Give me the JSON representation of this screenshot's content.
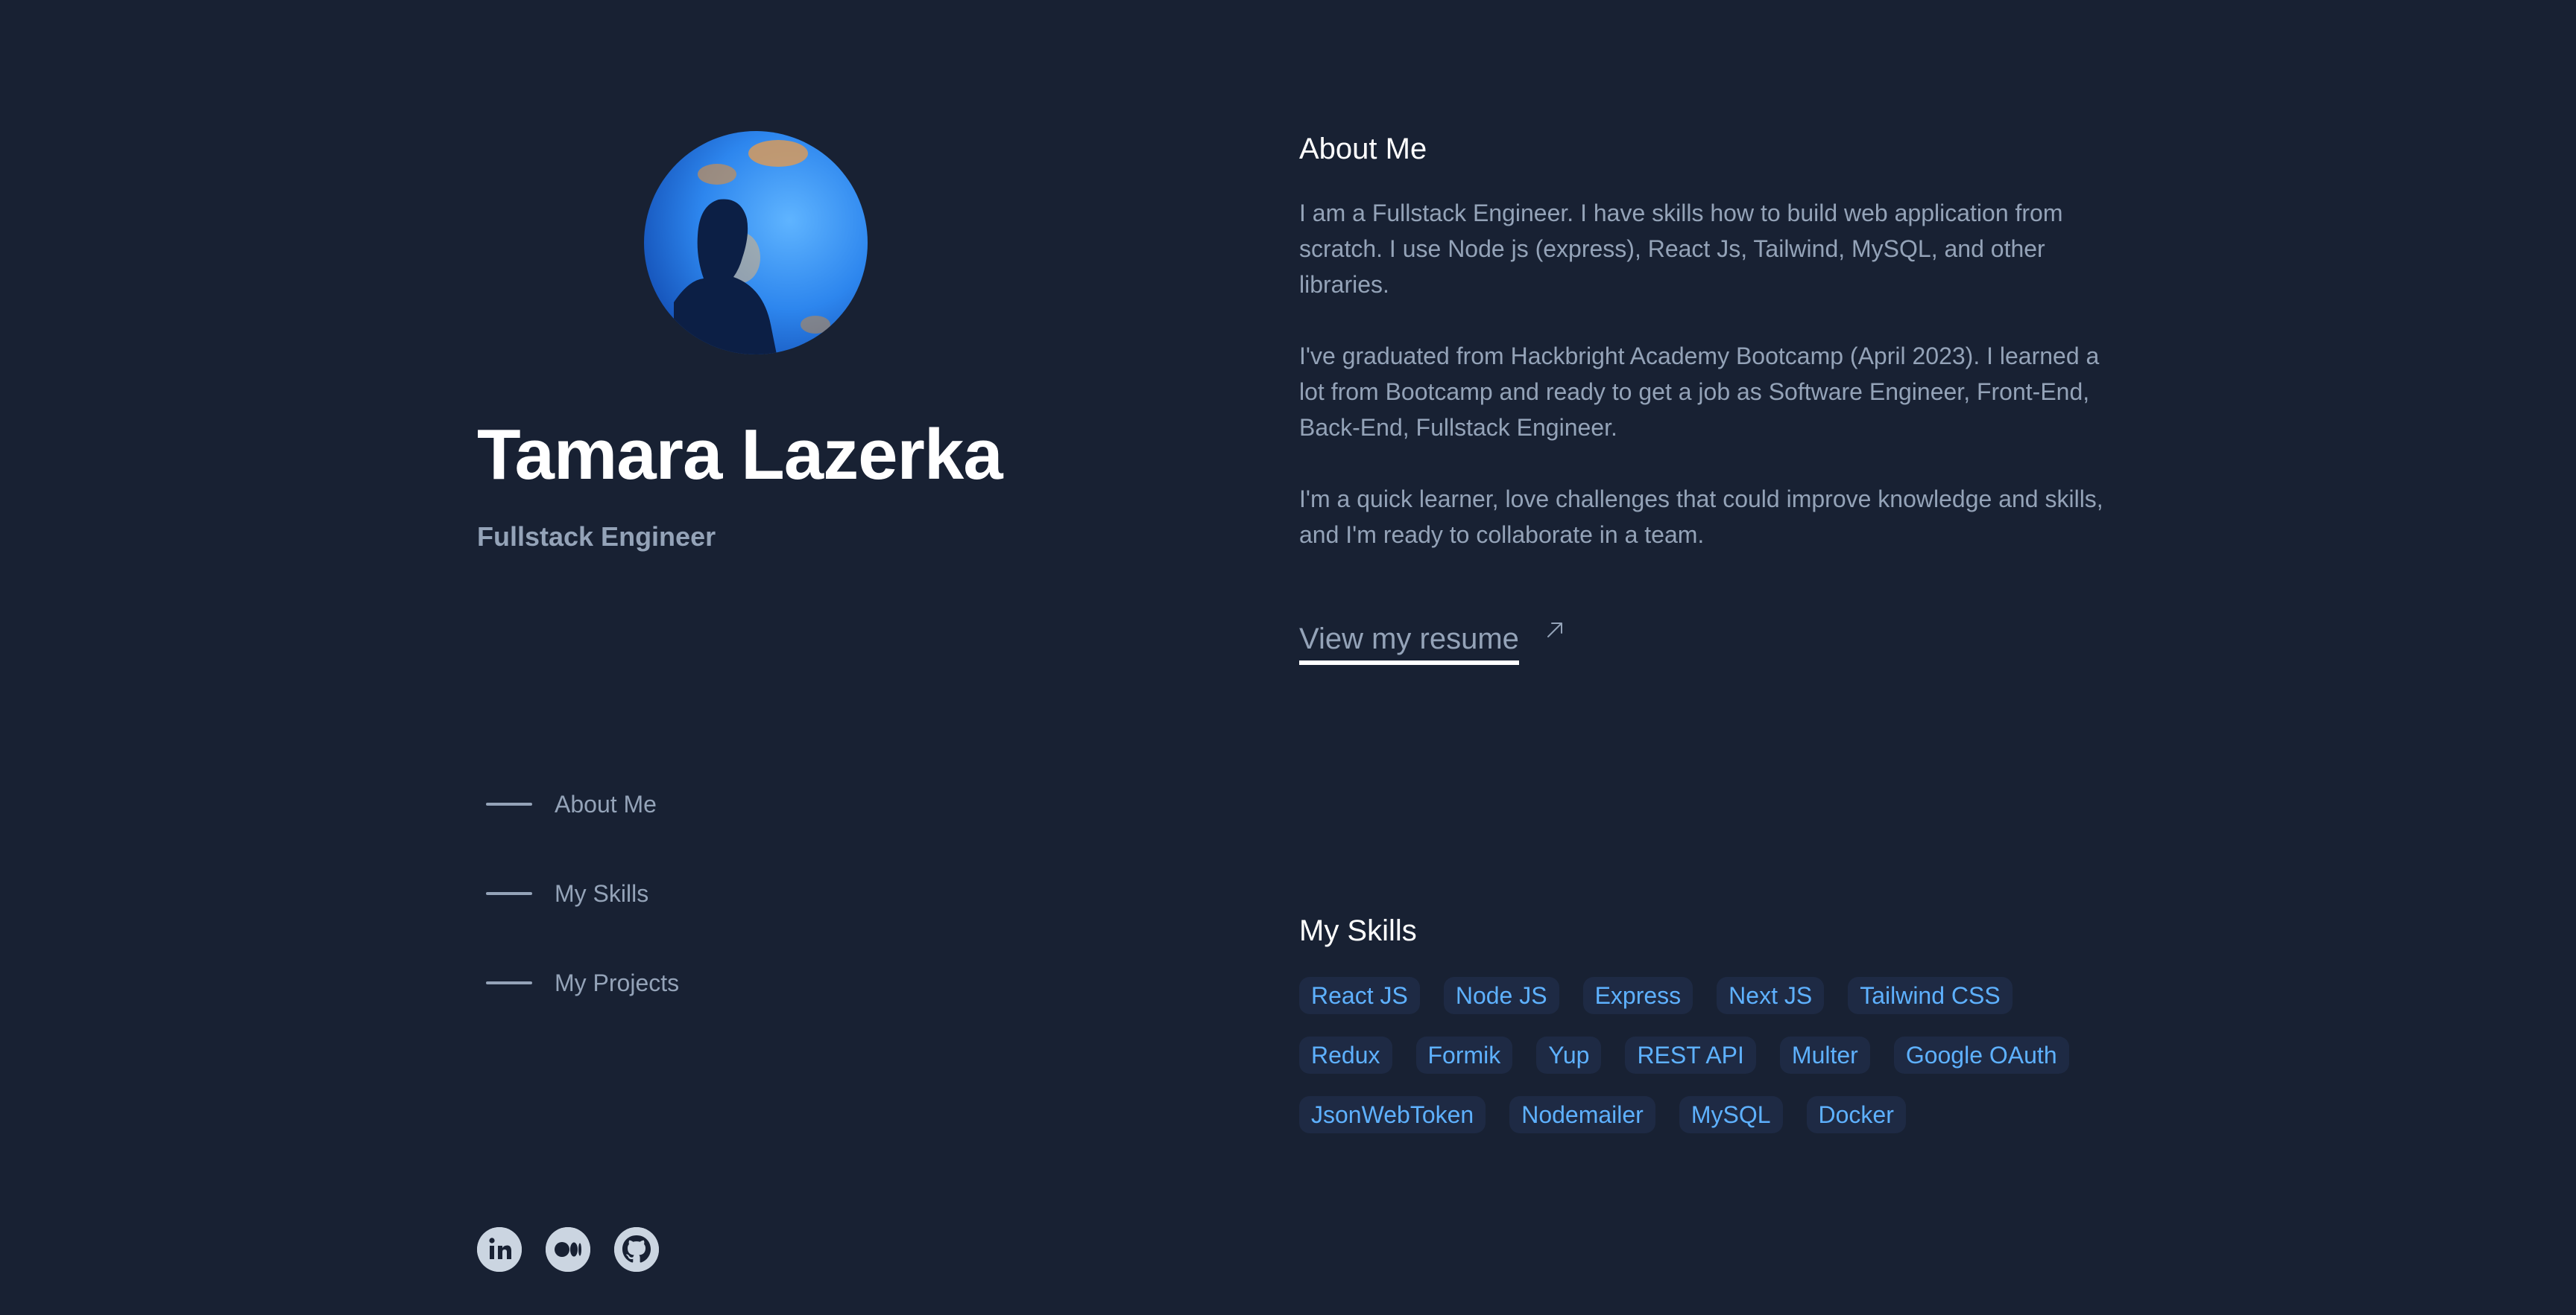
{
  "profile": {
    "name": "Tamara Lazerka",
    "role": "Fullstack Engineer"
  },
  "nav": {
    "items": [
      {
        "label": "About Me"
      },
      {
        "label": "My Skills"
      },
      {
        "label": "My Projects"
      }
    ]
  },
  "about": {
    "title": "About Me",
    "paragraphs": [
      "I am a Fullstack Engineer. I have skills how to build web application from scratch. I use Node js (express), React Js, Tailwind, MySQL, and other libraries.",
      "I've graduated from Hackbright Academy Bootcamp (April 2023). I learned a lot from Bootcamp and ready to get a job as Software Engineer, Front-End, Back-End, Fullstack Engineer.",
      "I'm a quick learner, love challenges that could improve knowledge and skills, and I'm ready to collaborate in a team."
    ],
    "resume_label": "View my resume"
  },
  "skills": {
    "title": "My Skills",
    "rows": [
      [
        "React JS",
        "Node JS",
        "Express",
        "Next JS",
        "Tailwind CSS"
      ],
      [
        "Redux",
        "Formik",
        "Yup",
        "REST API",
        "Multer",
        "Google OAuth"
      ],
      [
        "JsonWebToken",
        "Nodemailer",
        "MySQL",
        "Docker"
      ]
    ]
  },
  "socials": [
    {
      "icon": "linkedin-icon"
    },
    {
      "icon": "medium-icon"
    },
    {
      "icon": "github-icon"
    }
  ],
  "colors": {
    "background": "#182133",
    "heading": "#ffffff",
    "text": "#94a3b8",
    "chip_text": "#5eb1ff",
    "chip_bg": "#1e2a44"
  }
}
